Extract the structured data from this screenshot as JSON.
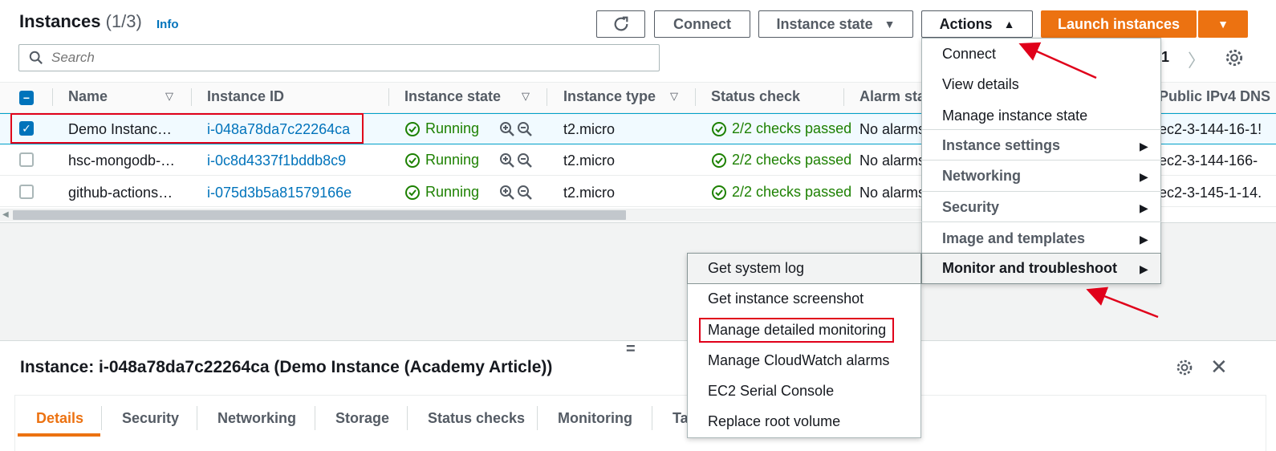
{
  "header": {
    "title": "Instances",
    "count": "(1/3)",
    "info": "Info"
  },
  "toolbar": {
    "connect": "Connect",
    "instance_state": "Instance state",
    "actions": "Actions",
    "launch": "Launch instances",
    "search_placeholder": "Search",
    "page": "1"
  },
  "table": {
    "columns": [
      "Name",
      "Instance ID",
      "Instance state",
      "Instance type",
      "Status check",
      "Alarm sta",
      "Public IPv4 DNS"
    ],
    "rows": [
      {
        "name": "Demo Instanc…",
        "id": "i-048a78da7c22264ca",
        "state": "Running",
        "type": "t2.micro",
        "status": "2/2 checks passed",
        "alarm": "No alarms",
        "dns": "ec2-3-144-16-1!",
        "selected": true
      },
      {
        "name": "hsc-mongodb-…",
        "id": "i-0c8d4337f1bddb8c9",
        "state": "Running",
        "type": "t2.micro",
        "status": "2/2 checks passed",
        "alarm": "No alarms",
        "dns": "ec2-3-144-166-",
        "selected": false
      },
      {
        "name": "github-actions…",
        "id": "i-075d3b5a81579166e",
        "state": "Running",
        "type": "t2.micro",
        "status": "2/2 checks passed",
        "alarm": "No alarms",
        "dns": "ec2-3-145-1-14.",
        "selected": false
      }
    ]
  },
  "actions_menu": {
    "items": [
      "Connect",
      "View details",
      "Manage instance state"
    ],
    "groups": [
      "Instance settings",
      "Networking",
      "Security",
      "Image and templates",
      "Monitor and troubleshoot"
    ]
  },
  "submenu": {
    "items": [
      "Get system log",
      "Get instance screenshot",
      "Manage detailed monitoring",
      "Manage CloudWatch alarms",
      "EC2 Serial Console",
      "Replace root volume"
    ]
  },
  "details": {
    "title": "Instance: i-048a78da7c22264ca (Demo Instance (Academy Article))",
    "tabs": [
      "Details",
      "Security",
      "Networking",
      "Storage",
      "Status checks",
      "Monitoring",
      "Ta"
    ]
  },
  "colors": {
    "accent": "#ec7211",
    "link": "#0073bb",
    "success": "#1d8102",
    "annotation": "#e0001a"
  },
  "icons": [
    "refresh-icon",
    "caret-down-icon",
    "caret-up-icon",
    "search-icon",
    "chevron-right-icon",
    "gear-icon",
    "check-circle-icon",
    "zoom-in-icon",
    "zoom-out-icon",
    "close-icon",
    "sort-icon"
  ]
}
